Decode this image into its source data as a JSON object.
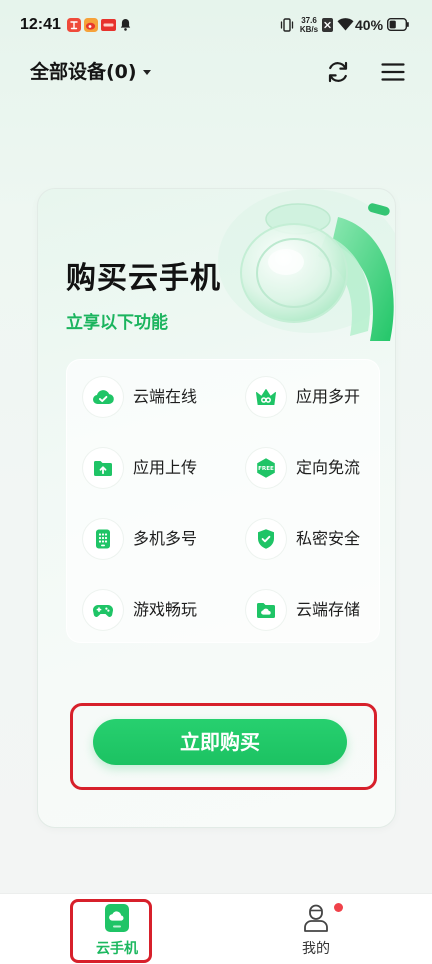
{
  "status_bar": {
    "time": "12:41",
    "notification_icons": [
      "red-app-icon",
      "weibo-icon",
      "red-tag-icon",
      "bell-icon"
    ],
    "net_speed": {
      "value": "37.6",
      "unit": "KB/s"
    },
    "battery_level": "40%"
  },
  "header": {
    "device_selector_label": "全部设备(0)",
    "actions": [
      "refresh-icon",
      "menu-icon"
    ]
  },
  "promo": {
    "title": "购买云手机",
    "subtitle": "立享以下功能",
    "features": [
      {
        "label": "云端在线",
        "icon": "cloud-check-icon"
      },
      {
        "label": "应用多开",
        "icon": "crown-infinity-icon"
      },
      {
        "label": "应用上传",
        "icon": "folder-upload-icon"
      },
      {
        "label": "定向免流",
        "icon": "free-badge-icon",
        "icon_text": "FREE"
      },
      {
        "label": "多机多号",
        "icon": "keypad-phone-icon"
      },
      {
        "label": "私密安全",
        "icon": "shield-check-icon"
      },
      {
        "label": "游戏畅玩",
        "icon": "gamepad-icon"
      },
      {
        "label": "云端存储",
        "icon": "folder-cloud-icon"
      }
    ],
    "buy_button_label": "立即购买"
  },
  "bottom_nav": {
    "items": [
      {
        "label": "云手机",
        "icon": "cloud-phone-icon",
        "active": true
      },
      {
        "label": "我的",
        "icon": "person-icon",
        "active": false,
        "has_badge": true
      }
    ]
  },
  "colors": {
    "accent": "#1fc466",
    "subtitle_green": "#1bb45e",
    "badge_red": "#f0424a",
    "annotation_red": "#d7202b"
  }
}
